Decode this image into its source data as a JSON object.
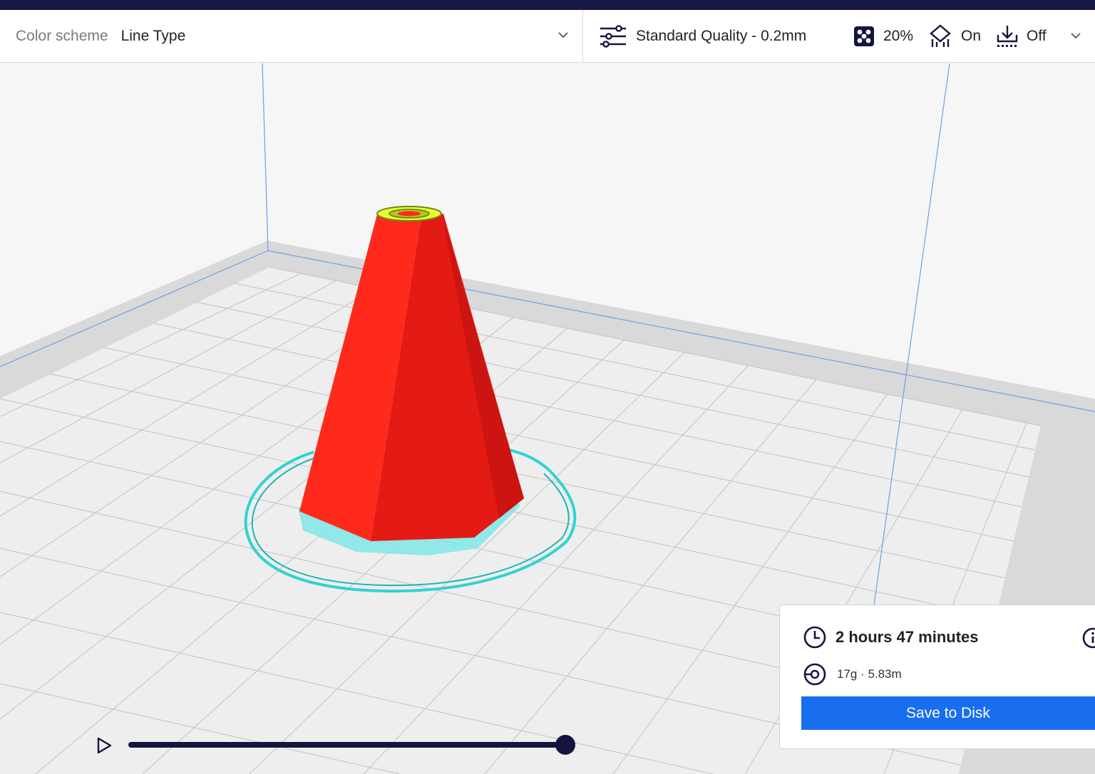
{
  "header": {
    "color_scheme_label": "Color scheme",
    "color_scheme_value": "Line Type",
    "profile": "Standard Quality - 0.2mm",
    "infill": "20%",
    "support": "On",
    "adhesion": "Off",
    "icons": {
      "chevron": "chevron-down-icon",
      "profile": "sliders-icon",
      "infill": "infill-icon",
      "support": "support-icon",
      "adhesion": "adhesion-icon"
    }
  },
  "print_info": {
    "time": "2 hours 47 minutes",
    "material": "17g · 5.83m",
    "save_label": "Save to Disk"
  },
  "layer_slider": {
    "progress": 1.0
  },
  "colors": {
    "accent": "#196ef0",
    "dark": "#141440",
    "model_wall": "#ff1a14",
    "skirt": "#32d2d2",
    "top_skin": "#e6ff32"
  }
}
